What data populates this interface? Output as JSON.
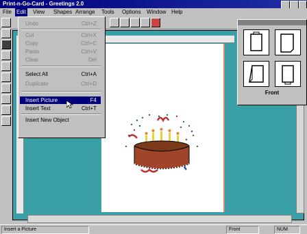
{
  "app": {
    "title": "Print-n-Go-Card",
    "document": "Greetings 2.0"
  },
  "menubar": [
    "File",
    "Edit",
    "View",
    "Shapes",
    "Arrange",
    "Tools",
    "Options",
    "Window",
    "Help"
  ],
  "edit_menu": {
    "items": [
      {
        "label": "Undo",
        "shortcut": "Ctrl+Z",
        "enabled": false
      },
      {
        "label": "Cut",
        "shortcut": "Ctrl+X",
        "enabled": false
      },
      {
        "label": "Copy",
        "shortcut": "Ctrl+C",
        "enabled": false
      },
      {
        "label": "Paste",
        "shortcut": "Ctrl+V",
        "enabled": false
      },
      {
        "label": "Clear",
        "shortcut": "Del",
        "enabled": false
      },
      {
        "label": "Select All",
        "shortcut": "Ctrl+A",
        "enabled": true
      },
      {
        "label": "Duplicate",
        "shortcut": "Ctrl+D",
        "enabled": false
      },
      {
        "label": "Insert Picture",
        "shortcut": "F4",
        "enabled": true,
        "highlight": true
      },
      {
        "label": "Insert Text",
        "shortcut": "Ctrl+T",
        "enabled": true
      },
      {
        "label": "Insert New Object",
        "shortcut": "",
        "enabled": true
      }
    ]
  },
  "panel": {
    "label": "Front"
  },
  "status": {
    "left": "Insert a Picture",
    "mid": "Front",
    "right": "NUM"
  },
  "colors": {
    "workspace": "#3b9fa8",
    "highlight": "#00007b"
  }
}
